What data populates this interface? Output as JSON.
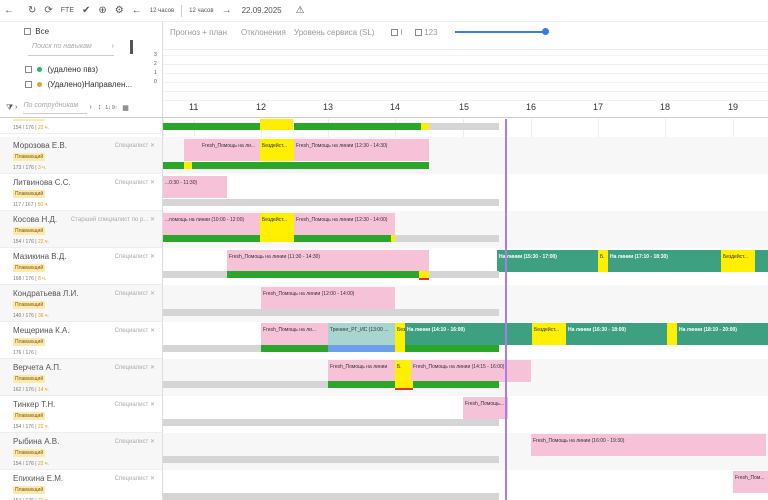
{
  "toolbar": {
    "fte_label": "FTE",
    "back_arrow": "←",
    "forward_arrow": "→",
    "interval_left": "12 часов",
    "interval_right": "12 часов",
    "date": "22.09.2025"
  },
  "left_panel": {
    "all_label": "Все",
    "skill_search_placeholder": "Поиск по навыкам",
    "skills": [
      {
        "label": "(удалено пвз)",
        "color": "#2ab07a"
      },
      {
        "label": "(Удалено)Направлен...",
        "color": "#e0a040"
      }
    ],
    "employee_search_placeholder": "По сотрудникам",
    "sort_label": "1↓ 9↑"
  },
  "tabs": {
    "forecast": "Прогноз + план",
    "deviations": "Отклонения",
    "service_level": "Уровень сервиса (SL)",
    "c1": "I",
    "c123": "123"
  },
  "mini_chart": {
    "y_ticks": [
      "3",
      "2",
      "1",
      "0"
    ]
  },
  "hours": [
    "11",
    "12",
    "13",
    "14",
    "15",
    "16",
    "17",
    "18",
    "19"
  ],
  "employees": [
    {
      "name": "",
      "role": "",
      "badge": "Плавающий",
      "stat": "154 / 176 |",
      "pct": "22 ч."
    },
    {
      "name": "Морозова Е.В.",
      "role": "Специалист",
      "badge": "Плавающий",
      "stat": "173 / 176 |",
      "pct": "3 ч."
    },
    {
      "name": "Литвинова С.С.",
      "role": "Специалист",
      "badge": "Плавающий",
      "stat": "117 / 167 |",
      "pct": "50 ч."
    },
    {
      "name": "Косова Н.Д.",
      "role": "Старший специалист по р...",
      "badge": "Плавающий",
      "stat": "154 / 176 |",
      "pct": "22 ч."
    },
    {
      "name": "Мазикина В.Д.",
      "role": "Специалист",
      "badge": "Плавающий",
      "stat": "168 / 176 |",
      "pct": "8 ч."
    },
    {
      "name": "Кондратьева Л.И.",
      "role": "Специалист",
      "badge": "Плавающий",
      "stat": "140 / 176 |",
      "pct": "36 ч."
    },
    {
      "name": "Мещерина К.А.",
      "role": "Специалист",
      "badge": "Плавающий",
      "stat": "176 / 176 |",
      "pct": ""
    },
    {
      "name": "Верчета А.П.",
      "role": "Специалист",
      "badge": "Плавающий",
      "stat": "162 / 176 |",
      "pct": "14 ч."
    },
    {
      "name": "Тинкер Т.Н.",
      "role": "Специалист",
      "badge": "Плавающий",
      "stat": "154 / 176 |",
      "pct": "22 ч."
    },
    {
      "name": "Рыбина А.В.",
      "role": "Специалист",
      "badge": "Плавающий",
      "stat": "154 / 176 |",
      "pct": "22 ч."
    },
    {
      "name": "Епихина Е.М.",
      "role": "Специалист",
      "badge": "Плавающий",
      "stat": "154 / 176 |",
      "pct": "22 ч."
    }
  ],
  "shifts": {
    "b_fresh_1230_1430": "Fresh_Помощь на линии (12:30 - 14:30)",
    "b_fresh_short": "Fresh_Помощь на ли...",
    "b_idle": "Бездейст...",
    "b_fresh_1030_1130": "...0:30 - 11:30)",
    "b_fresh_1000_1200": "...помощь на линии (10:00 - 12:00)",
    "b_fresh_1230_1400": "Fresh_Помощь на линии (12:30 - 14:00)",
    "b_fresh_1130_1430": "Fresh_Помощь на линии (11:30 - 14:30)",
    "b_line_1530_1700": "На линии (15:30 - 17:00)",
    "b_e": "Б.",
    "b_line_1710_1830": "На линии (17:10 - 18:30)",
    "b_idle2": "Бездейст...",
    "b_fresh_1200_1400": "Fresh_Помощь на линии (12:00 - 14:00)",
    "b_fresh_short2": "Fresh_Помощь на ли...",
    "b_training": "Тренинг_РГ_ИС (13:00 ...",
    "b_line_1410_1600": "На линии (14:10 - 16:00)",
    "b_idle3": "Бездейст...",
    "b_line_1630_1800": "На линии (16:30 - 18:00)",
    "b_line_1810_2000": "На линии (18:10 - 20:00)",
    "b_fresh_short3": "Fresh_Помощь на линии",
    "b_fresh_1415_1600": "Fresh_Помощь на линии (14:15 - 16:00)",
    "b_fresh_short4": "Fresh_Помощь...",
    "b_fresh_1600_1930": "Fresh_Помощь на линии (16:00 - 19:30)",
    "b_fresh_short5": "Fresh_Пом..."
  },
  "colors": {
    "pink": "#f5c2d8",
    "yellow": "#ffef00",
    "green": "#2ba62b",
    "teal": "#3da080",
    "now_line": "#a87ee6"
  }
}
